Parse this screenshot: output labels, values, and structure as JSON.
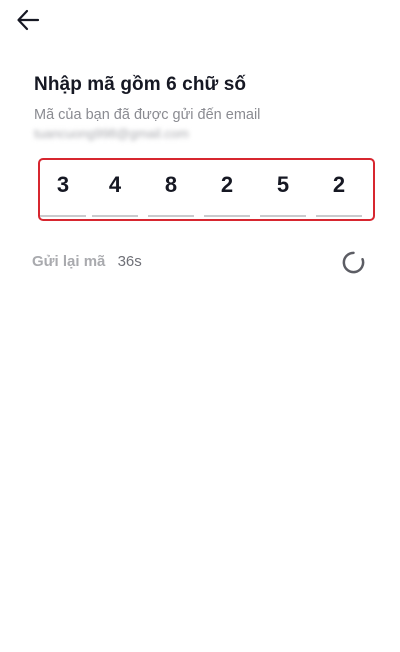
{
  "header": {
    "back_icon": "arrow-left-icon"
  },
  "verification": {
    "title": "Nhập mã gồm 6 chữ số",
    "subtitle": "Mã của bạn đã được gửi đến email",
    "email": "tuancuong998@gmail.com",
    "digits": [
      "3",
      "4",
      "8",
      "2",
      "5",
      "2"
    ],
    "highlight_color": "#d7262f"
  },
  "resend": {
    "label": "Gửi lại mã",
    "countdown": "36s",
    "spinner_icon": "loading-spinner-icon"
  }
}
